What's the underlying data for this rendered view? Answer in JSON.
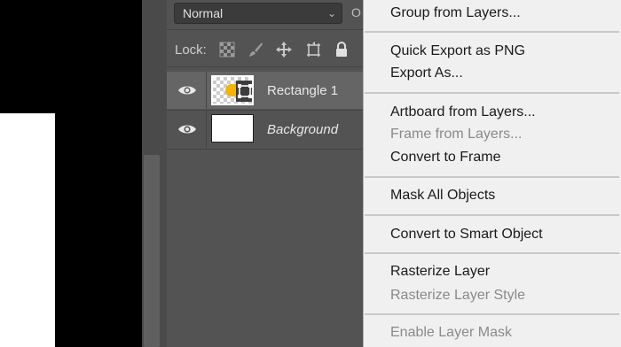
{
  "layers_panel": {
    "blend_mode": "Normal",
    "opacity_label": "O",
    "lock_label": "Lock:",
    "lock_icons": [
      "lock-transparent-pixels-icon",
      "lock-image-pixels-icon",
      "lock-position-icon",
      "lock-artboard-icon",
      "lock-all-icon"
    ],
    "layers": [
      {
        "name": "Rectangle 1",
        "visible": true,
        "selected": true,
        "type": "smart-object"
      },
      {
        "name": "Background",
        "visible": true,
        "selected": false,
        "type": "background"
      }
    ]
  },
  "context_menu": {
    "items": [
      {
        "label": "Group from Layers...",
        "enabled": true
      },
      {
        "label": "Quick Export as PNG",
        "enabled": true
      },
      {
        "label": "Export As...",
        "enabled": true
      },
      {
        "label": "Artboard from Layers...",
        "enabled": true
      },
      {
        "label": "Frame from Layers...",
        "enabled": false
      },
      {
        "label": "Convert to Frame",
        "enabled": true
      },
      {
        "label": "Mask All Objects",
        "enabled": true
      },
      {
        "label": "Convert to Smart Object",
        "enabled": true
      },
      {
        "label": "Rasterize Layer",
        "enabled": true
      },
      {
        "label": "Rasterize Layer Style",
        "enabled": false
      },
      {
        "label": "Enable Layer Mask",
        "enabled": false
      }
    ]
  },
  "colors": {
    "panel_bg": "#535353",
    "selected_row": "#656565",
    "menu_bg": "#f0f0f0",
    "shape_fill": "#f5b400"
  }
}
